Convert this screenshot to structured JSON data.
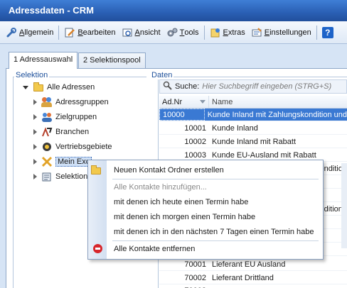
{
  "window": {
    "title": "Adressdaten - CRM"
  },
  "toolbar": {
    "items": [
      {
        "label": "Allgemein",
        "underline": "A",
        "rest": "llgemein"
      },
      {
        "label": "Bearbeiten",
        "underline": "B",
        "rest": "earbeiten"
      },
      {
        "label": "Ansicht",
        "underline": "A",
        "rest": "nsicht"
      },
      {
        "label": "Tools",
        "underline": "T",
        "rest": "ools"
      },
      {
        "label": "Extras",
        "underline": "E",
        "rest": "xtras"
      },
      {
        "label": "Einstellungen",
        "underline": "E",
        "rest": "instellungen"
      }
    ],
    "help_label": "?"
  },
  "tabs": [
    {
      "label": "1 Adressauswahl"
    },
    {
      "label": "2 Selektionspool"
    }
  ],
  "selektion": {
    "group_label": "Selektion",
    "root": "Alle Adressen",
    "items": [
      "Adressgruppen",
      "Zielgruppen",
      "Branchen",
      "Vertriebsgebiete",
      "Mein Exc",
      "Selektion"
    ]
  },
  "daten": {
    "group_label": "Daten",
    "search_label": "Suche:",
    "search_placeholder": "Hier Suchbegriff eingeben (STRG+S)",
    "columns": [
      "Ad.Nr",
      "Name"
    ],
    "rows": [
      {
        "adnr": "10000",
        "name": "Kunde Inland mit Zahlungskondition und",
        "selected": true
      },
      {
        "adnr": "10001",
        "name": "Kunde Inland"
      },
      {
        "adnr": "10002",
        "name": "Kunde Inland mit Rabatt"
      },
      {
        "adnr": "10003",
        "name": "Kunde EU-Ausland mit Rabatt"
      },
      {
        "adnr": "",
        "name": "ondition"
      },
      {
        "adnr": "",
        "name": ""
      },
      {
        "adnr": "",
        "name": ""
      },
      {
        "adnr": "",
        "name": "onditione"
      },
      {
        "adnr": "",
        "name": ""
      },
      {
        "adnr": "",
        "name": ""
      },
      {
        "adnr": "",
        "name": ""
      },
      {
        "adnr": "70001",
        "name": "Lieferant EU Ausland"
      },
      {
        "adnr": "70002",
        "name": "Lieferant Drittland"
      },
      {
        "adnr": "70003",
        "name": ""
      }
    ]
  },
  "context_menu": {
    "items": [
      {
        "label": "Neuen Kontakt Ordner erstellen",
        "icon": "folder-icon",
        "disabled": false
      },
      {
        "label": "Alle Kontakte hinzufügen...",
        "icon": "",
        "disabled": true
      },
      {
        "label": "mit denen ich heute einen Termin habe",
        "icon": "",
        "disabled": false
      },
      {
        "label": "mit denen ich morgen einen Termin habe",
        "icon": "",
        "disabled": false
      },
      {
        "label": "mit denen ich in den nächsten 7 Tagen einen Termin habe",
        "icon": "",
        "disabled": false
      },
      {
        "label": "Alle Kontakte entfernen",
        "icon": "remove-icon",
        "disabled": false
      }
    ]
  },
  "colors": {
    "titlebar": "#2a5fb4",
    "selection": "#3a79d3",
    "remove": "#d7262b"
  }
}
